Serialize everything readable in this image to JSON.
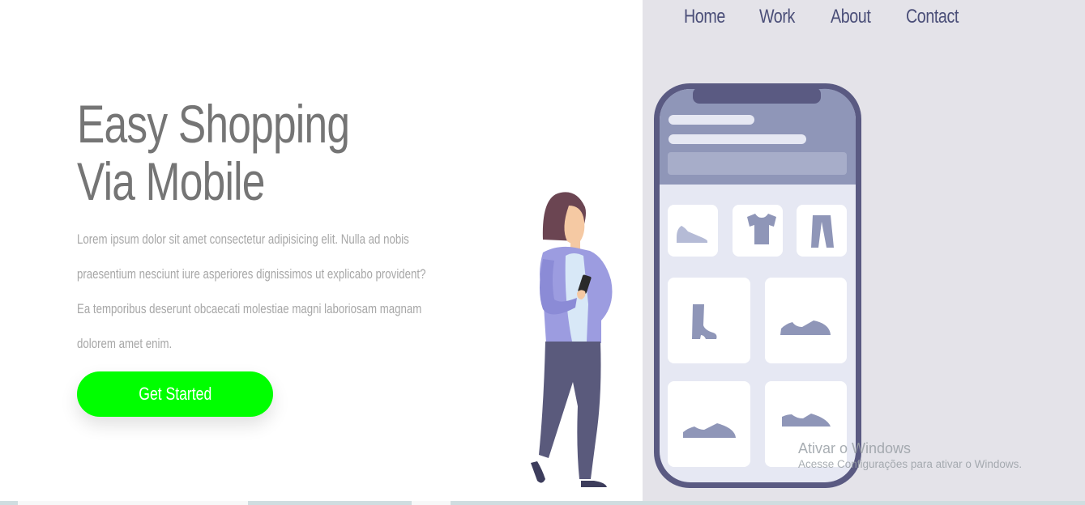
{
  "nav": {
    "items": [
      {
        "label": "Home"
      },
      {
        "label": "Work"
      },
      {
        "label": "About"
      },
      {
        "label": "Contact"
      }
    ]
  },
  "hero": {
    "title_line1": "Easy Shopping",
    "title_line2": "Via Mobile",
    "paragraph_lines": [
      "Lorem ipsum dolor sit amet consectetur adipisicing elit. Nulla ad nobis",
      "praesentium nesciunt iure asperiores dignissimos ut explicabo provident?",
      "Ea temporibus deserunt obcaecati molestiae magni laboriosam magnam",
      "dolorem amet enim."
    ],
    "cta_label": "Get Started"
  },
  "watermark": {
    "title": "Ativar o Windows",
    "subtitle": "Acesse Configurações para ativar o Windows."
  },
  "colors": {
    "accent_green": "#00ff00",
    "nav_text": "#4a4e78",
    "panel_bg": "#e4e3e9",
    "phone_frame": "#5a5a82",
    "phone_screen": "#e6e8f3",
    "product_icon": "#8f96b8"
  },
  "icons": {
    "product_grid": [
      "sneaker-icon",
      "tshirt-icon",
      "pants-icon",
      "boot-icon",
      "sneaker-icon",
      "sneaker-icon",
      "sneaker-icon"
    ]
  }
}
